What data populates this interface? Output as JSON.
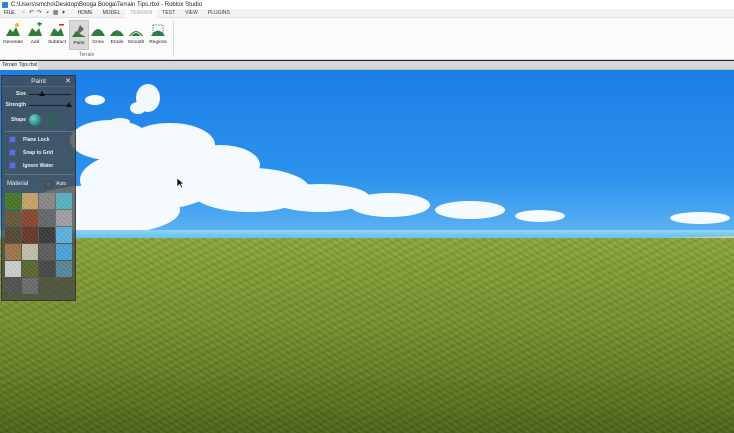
{
  "window": {
    "title": "C:\\Users\\smcho\\Desktop\\Booga Booga\\Terrain Tips.rbxl - Roblox Studio"
  },
  "menu": {
    "file_label": "FILE",
    "tabs": [
      {
        "label": "HOME"
      },
      {
        "label": "MODEL"
      },
      {
        "label": "TERRAIN",
        "active": true
      },
      {
        "label": "TEST"
      },
      {
        "label": "VIEW"
      },
      {
        "label": "PLUGINS"
      }
    ]
  },
  "ribbon": {
    "tools": [
      {
        "label": "Generate",
        "icon": "generate-icon"
      },
      {
        "label": "Add",
        "icon": "add-terrain-icon"
      },
      {
        "label": "Subtract",
        "icon": "subtract-terrain-icon"
      },
      {
        "label": "Paint",
        "icon": "paint-terrain-icon",
        "active": true
      },
      {
        "label": "Grow",
        "icon": "grow-terrain-icon"
      },
      {
        "label": "Erode",
        "icon": "erode-terrain-icon"
      },
      {
        "label": "Smooth",
        "icon": "smooth-terrain-icon"
      },
      {
        "label": "Regions",
        "icon": "regions-icon"
      }
    ],
    "group_label": "Terrain"
  },
  "document_tab": {
    "label": "Terrain Tips.rbxl"
  },
  "panel": {
    "title": "Paint",
    "close_glyph": "✕",
    "size_label": "Size",
    "size_value": 0.3,
    "strength_label": "Strength",
    "strength_value": 0.95,
    "shape_label": "Shape",
    "options": [
      {
        "label": "Plane Lock"
      },
      {
        "label": "Snap to Grid"
      },
      {
        "label": "Ignore Water"
      }
    ],
    "material_label": "Material",
    "auto_label": "Auto",
    "materials": [
      {
        "name": "grass",
        "color": "#4c7a25",
        "selected": true
      },
      {
        "name": "sand",
        "color": "#c9a86b"
      },
      {
        "name": "rock",
        "color": "#8c8c8c"
      },
      {
        "name": "glacier",
        "color": "#5ab7c8"
      },
      {
        "name": "ground",
        "color": "#6a5a3e"
      },
      {
        "name": "brick",
        "color": "#8c4a33"
      },
      {
        "name": "slate",
        "color": "#676b6e"
      },
      {
        "name": "concrete",
        "color": "#a4a4a4"
      },
      {
        "name": "mud",
        "color": "#5a4a34"
      },
      {
        "name": "cracked-lava",
        "color": "#6c3a2a"
      },
      {
        "name": "basalt",
        "color": "#3d3d3d"
      },
      {
        "name": "ice",
        "color": "#5fb6e3"
      },
      {
        "name": "sandstone",
        "color": "#a4784d"
      },
      {
        "name": "limestone",
        "color": "#c8c2b0"
      },
      {
        "name": "pavement",
        "color": "#5f5f5f"
      },
      {
        "name": "salt",
        "color": "#4fa6e0"
      },
      {
        "name": "snow",
        "color": "#d3d3d3"
      },
      {
        "name": "leafy-grass",
        "color": "#5b6b34"
      },
      {
        "name": "asphalt",
        "color": "#4a4a4a"
      },
      {
        "name": "water",
        "color": "#5a8aa0"
      },
      {
        "name": "empty",
        "color": "#555555"
      },
      {
        "name": "cobblestone",
        "color": "#6f6f6f"
      }
    ]
  },
  "colors": {
    "sky_top": "#1b7fe6",
    "grass": "#7f9a32",
    "checkbox_blue": "#5773d6",
    "panel_bg": "#464646"
  }
}
